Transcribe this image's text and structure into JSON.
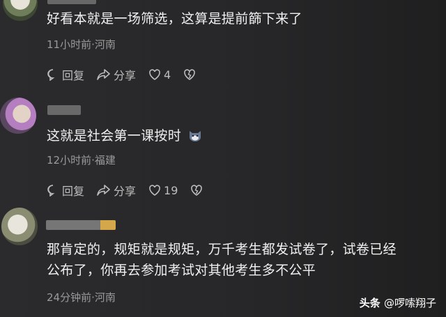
{
  "comments": [
    {
      "text": "好看本就是一场筛选，这算是提前篩下来了",
      "meta": "11小时前·河南",
      "reply_label": "回复",
      "share_label": "分享",
      "likes": "4"
    },
    {
      "text": "这就是社会第一课按时",
      "meta": "12小时前·福建",
      "reply_label": "回复",
      "share_label": "分享",
      "likes": "19"
    },
    {
      "text_line1": "那肯定的，规矩就是规矩，万千考生都发试卷了，试卷已经",
      "text_line2": "公布了，你再去参加考试对其他考生多不公平",
      "meta": "24分钟前·河南"
    }
  ],
  "watermark": {
    "brand": "头条",
    "handle": "@啰嗦翔子"
  },
  "icons": [
    "reply-icon",
    "share-icon",
    "heart-icon",
    "broken-heart-icon",
    "cat-emoji-icon"
  ]
}
